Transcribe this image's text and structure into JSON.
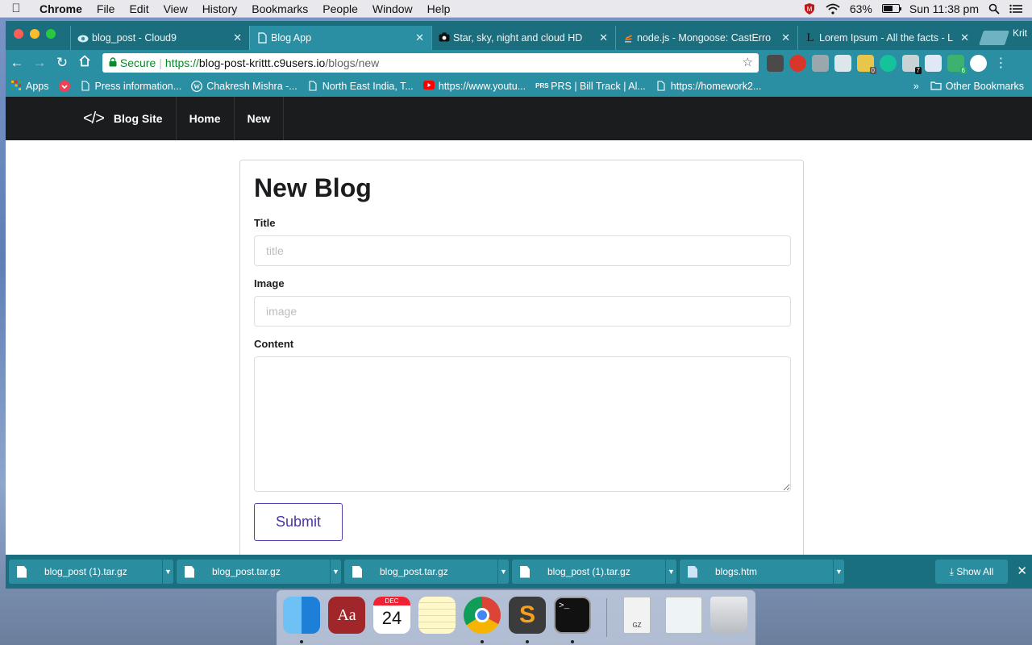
{
  "menubar": {
    "app_name": "Chrome",
    "menus": [
      "File",
      "Edit",
      "View",
      "History",
      "Bookmarks",
      "People",
      "Window",
      "Help"
    ],
    "battery_percent": "63%",
    "battery_level": 0.63,
    "clock": "Sun 11:38 pm"
  },
  "browser": {
    "tabs": [
      {
        "title": "blog_post - Cloud9",
        "icon": "cloud9-icon",
        "active": false
      },
      {
        "title": "Blog App",
        "icon": "page-icon",
        "active": true
      },
      {
        "title": "Star, sky, night and cloud HD",
        "icon": "camera-icon",
        "active": false
      },
      {
        "title": "node.js - Mongoose: CastErro",
        "icon": "stackoverflow-icon",
        "active": false
      },
      {
        "title": "Lorem Ipsum - All the facts - L",
        "icon": "lipsum-icon",
        "active": false
      }
    ],
    "profile_name": "Krit",
    "omnibox": {
      "secure_label": "Secure",
      "url_scheme": "https://",
      "url_host": "blog-post-krittt.c9users.io",
      "url_path": "/blogs/new"
    },
    "bookmarks": [
      {
        "label": "Apps",
        "icon": "apps-grid-icon"
      },
      {
        "label": "",
        "icon": "pocket-icon"
      },
      {
        "label": "Press information...",
        "icon": "page-icon"
      },
      {
        "label": "Chakresh Mishra -...",
        "icon": "wordpress-icon"
      },
      {
        "label": "North East India, T...",
        "icon": "page-icon"
      },
      {
        "label": "https://www.youtu...",
        "icon": "youtube-icon"
      },
      {
        "label": "PRS | Bill Track | Al...",
        "icon": "prs-icon"
      },
      {
        "label": "https://homework2...",
        "icon": "page-icon"
      }
    ],
    "bookmarks_overflow": "»",
    "other_bookmarks": "Other Bookmarks",
    "extension_badges": {
      "ext5": "0",
      "ext6": "7",
      "ext8": "6"
    }
  },
  "site": {
    "brand": "Blog Site",
    "nav": [
      "Home",
      "New"
    ]
  },
  "form": {
    "heading": "New Blog",
    "title_label": "Title",
    "title_placeholder": "title",
    "image_label": "Image",
    "image_placeholder": "image",
    "content_label": "Content",
    "content_value": "",
    "submit_label": "Submit"
  },
  "downloads": {
    "items": [
      "blog_post (1).tar.gz",
      "blog_post.tar.gz",
      "blog_post.tar.gz",
      "blog_post (1).tar.gz",
      "blogs.htm"
    ],
    "show_all": "Show All"
  },
  "dock": {
    "calendar_month": "DEC",
    "calendar_day": "24",
    "archive_label": "GZ"
  }
}
